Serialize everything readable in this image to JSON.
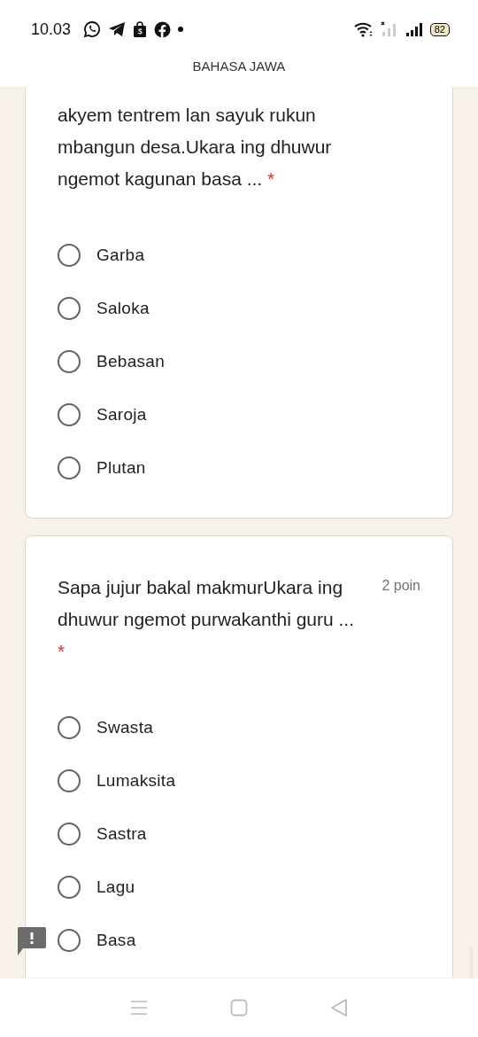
{
  "status_bar": {
    "time": "10.03",
    "battery": "82"
  },
  "header": {
    "title": "BAHASA JAWA"
  },
  "questions": [
    {
      "text": "akyem tentrem lan sayuk rukun mbangun desa.Ukara ing dhuwur ngemot kagunan basa ...",
      "required_mark": "*",
      "options": [
        {
          "label": "Garba",
          "selected": false
        },
        {
          "label": "Saloka",
          "selected": false
        },
        {
          "label": "Bebasan",
          "selected": false
        },
        {
          "label": "Saroja",
          "selected": false
        },
        {
          "label": "Plutan",
          "selected": false
        }
      ]
    },
    {
      "text": "Sapa jujur bakal makmurUkara ing dhuwur ngemot purwakanthi guru ...",
      "points": "2 poin",
      "required_mark": "*",
      "options": [
        {
          "label": "Swasta",
          "selected": false
        },
        {
          "label": "Lumaksita",
          "selected": false
        },
        {
          "label": "Sastra",
          "selected": false
        },
        {
          "label": "Lagu",
          "selected": false
        },
        {
          "label": "Basa",
          "selected": false
        }
      ]
    }
  ]
}
